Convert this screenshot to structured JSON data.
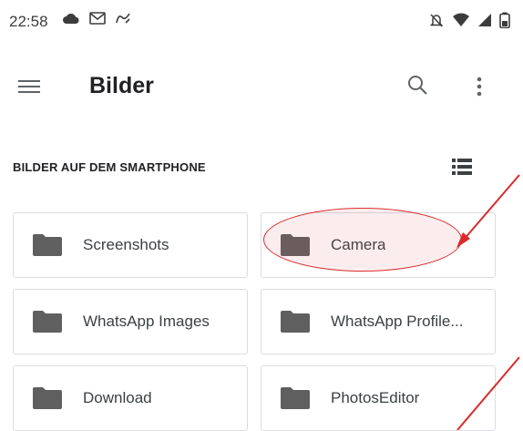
{
  "status_bar": {
    "time": "22:58",
    "left_icons": [
      "cloud-icon",
      "gmail-icon",
      "routes-icon"
    ],
    "right_icons": [
      "mute-icon",
      "wifi-icon",
      "signal-icon",
      "battery-icon"
    ]
  },
  "app_bar": {
    "title": "Bilder",
    "menu_icon": "hamburger-menu-icon",
    "search_icon": "search-icon",
    "more_icon": "more-vert-icon"
  },
  "section": {
    "header": "BILDER AUF DEM SMARTPHONE",
    "view_toggle_icon": "list-view-icon"
  },
  "folders": [
    {
      "label": "Screenshots"
    },
    {
      "label": "Camera"
    },
    {
      "label": "WhatsApp Images"
    },
    {
      "label": "WhatsApp Profile..."
    },
    {
      "label": "Download"
    },
    {
      "label": "PhotosEditor"
    }
  ],
  "annotation": {
    "color": "#d92b2b",
    "highlight_target": "Camera"
  },
  "colors": {
    "folder_icon": "#5f5f5f",
    "border": "#dadce0",
    "text": "#202124"
  }
}
